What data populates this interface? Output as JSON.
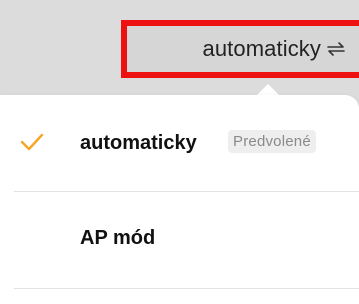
{
  "header": {
    "mode_label": "automaticky",
    "mode_icon": "swap-arrows-icon",
    "highlight_color": "#ee1111"
  },
  "menu": {
    "items": [
      {
        "label": "automaticky",
        "badge": "Predvolené",
        "selected": true,
        "check_icon": "checkmark-icon"
      },
      {
        "label": "AP mód",
        "selected": false
      }
    ]
  },
  "colors": {
    "accent": "#f5a623",
    "background": "#dcdcdc",
    "popover": "#ffffff",
    "badge_text": "#8a8a8a",
    "badge_bg": "#eeeeee"
  }
}
